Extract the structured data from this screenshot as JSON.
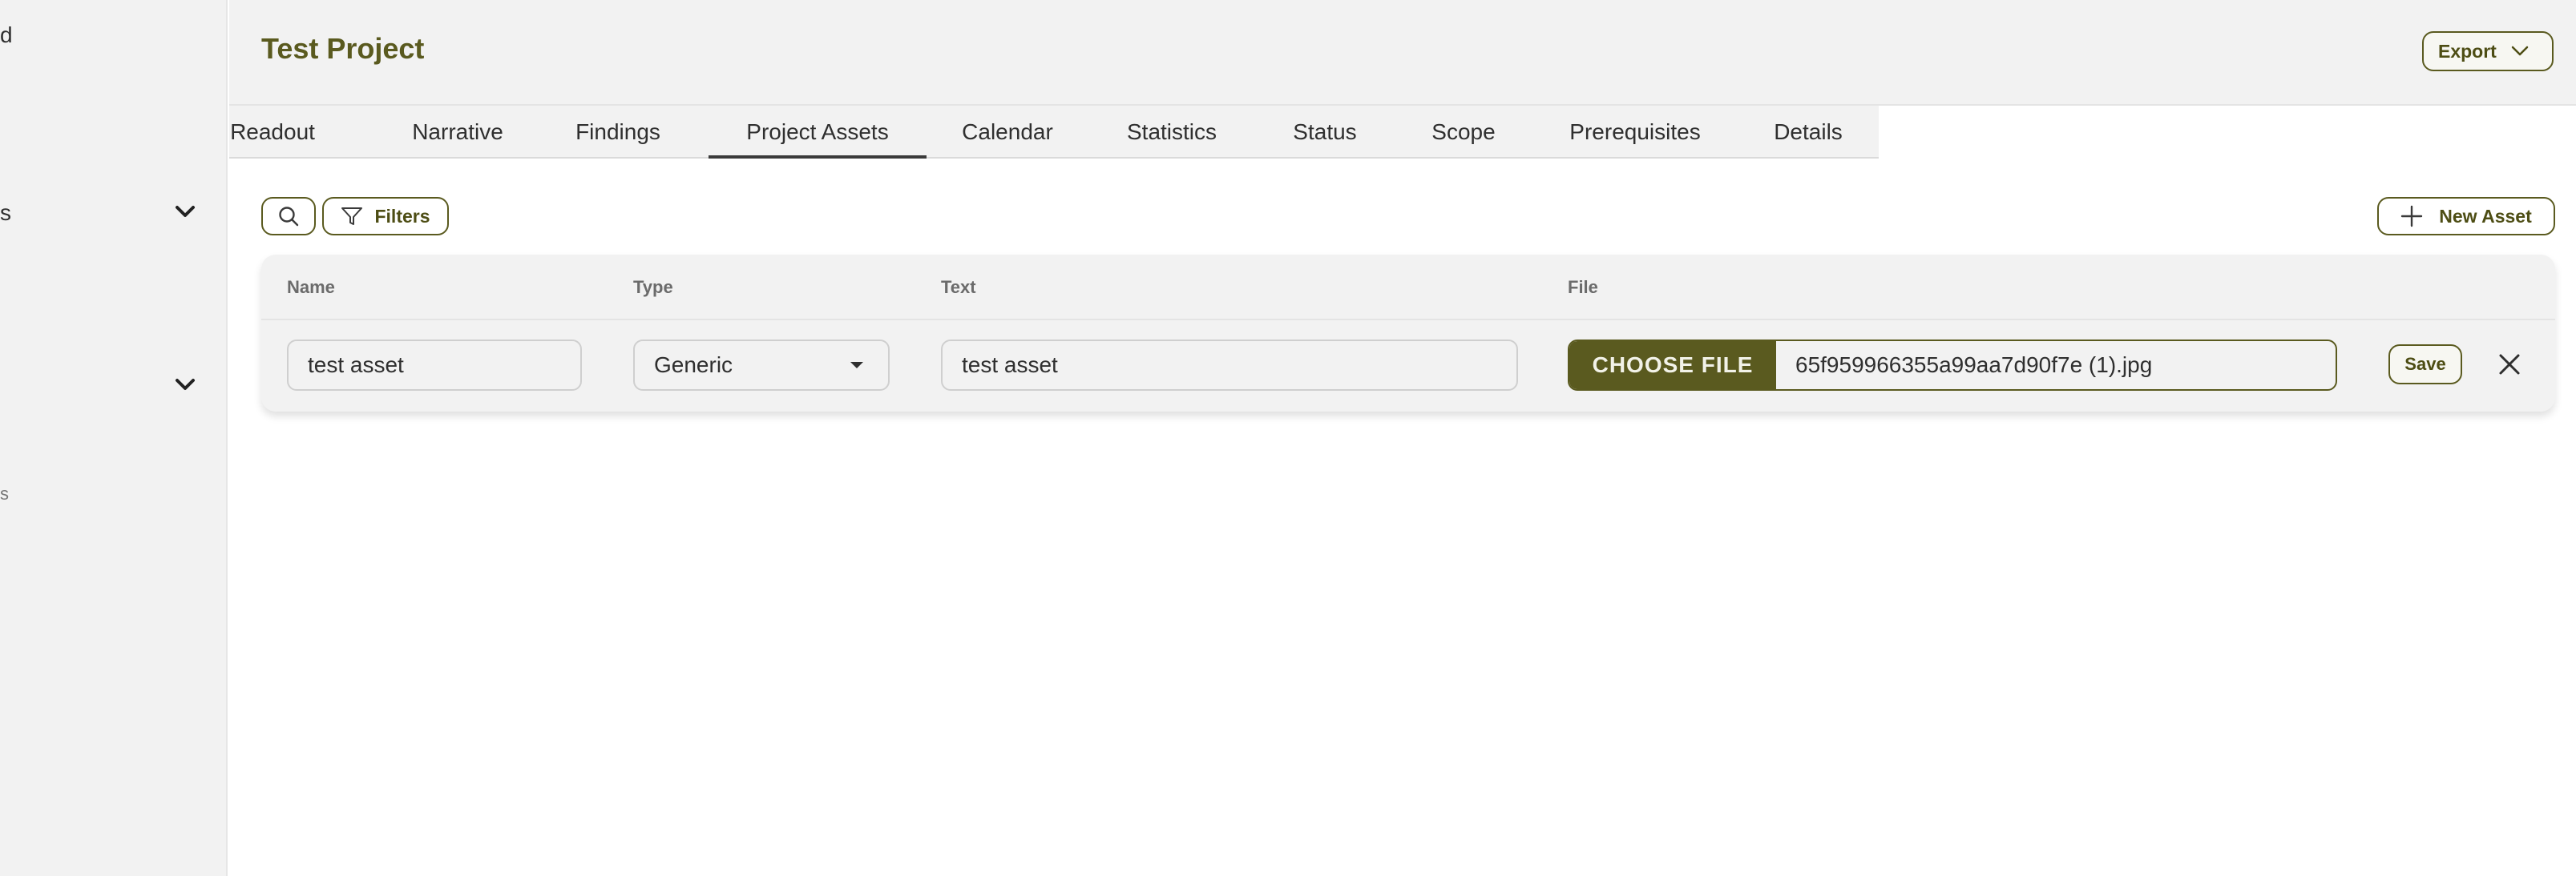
{
  "sidebar": {
    "fragments": [
      "d",
      "s",
      "s"
    ]
  },
  "header": {
    "title": "Test Project",
    "export_label": "Export"
  },
  "tabs": [
    {
      "label": "Readout"
    },
    {
      "label": "Narrative"
    },
    {
      "label": "Findings"
    },
    {
      "label": "Project Assets",
      "active": true
    },
    {
      "label": "Calendar"
    },
    {
      "label": "Statistics"
    },
    {
      "label": "Status"
    },
    {
      "label": "Scope"
    },
    {
      "label": "Prerequisites"
    },
    {
      "label": "Details"
    }
  ],
  "toolbar": {
    "filters_label": "Filters",
    "new_asset_label": "New Asset"
  },
  "table": {
    "columns": [
      "Name",
      "Type",
      "Text",
      "File"
    ],
    "row": {
      "name_value": "test asset",
      "type_value": "Generic",
      "text_value": "test asset",
      "choose_file_label": "CHOOSE FILE",
      "file_name": "65f959966355a99aa7d90f7e (1).jpg",
      "save_label": "Save"
    }
  },
  "colors": {
    "accent": "#5a5a1f",
    "sidebar_bg": "#f2f2f2",
    "page_bg": "#ffffff"
  },
  "icons": [
    "chevron-down-icon",
    "search-icon",
    "filter-icon",
    "plus-icon",
    "caret-down-icon",
    "close-icon"
  ]
}
